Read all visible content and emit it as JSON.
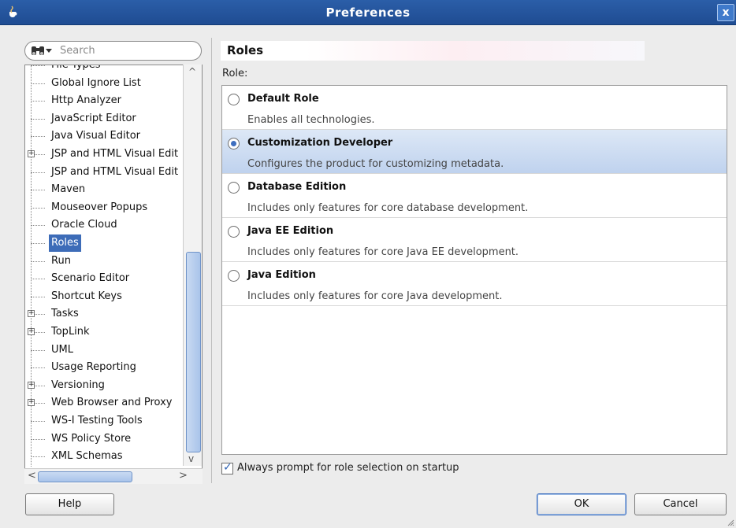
{
  "window": {
    "title": "Preferences",
    "close_label": "x"
  },
  "search": {
    "placeholder": "Search"
  },
  "tree": {
    "items": [
      {
        "label": "File Types",
        "expandable": false
      },
      {
        "label": "Global Ignore List",
        "expandable": false
      },
      {
        "label": "Http Analyzer",
        "expandable": false
      },
      {
        "label": "JavaScript Editor",
        "expandable": false
      },
      {
        "label": "Java Visual Editor",
        "expandable": false
      },
      {
        "label": "JSP and HTML Visual Edit",
        "expandable": true
      },
      {
        "label": "JSP and HTML Visual Edit",
        "expandable": false
      },
      {
        "label": "Maven",
        "expandable": false
      },
      {
        "label": "Mouseover Popups",
        "expandable": false
      },
      {
        "label": "Oracle Cloud",
        "expandable": false
      },
      {
        "label": "Roles",
        "expandable": false,
        "selected": true
      },
      {
        "label": "Run",
        "expandable": false
      },
      {
        "label": "Scenario Editor",
        "expandable": false
      },
      {
        "label": "Shortcut Keys",
        "expandable": false
      },
      {
        "label": "Tasks",
        "expandable": true
      },
      {
        "label": "TopLink",
        "expandable": true
      },
      {
        "label": "UML",
        "expandable": false
      },
      {
        "label": "Usage Reporting",
        "expandable": false
      },
      {
        "label": "Versioning",
        "expandable": true
      },
      {
        "label": "Web Browser and Proxy",
        "expandable": true
      },
      {
        "label": "WS-I Testing Tools",
        "expandable": false
      },
      {
        "label": "WS Policy Store",
        "expandable": false
      },
      {
        "label": "XML Schemas",
        "expandable": false
      }
    ]
  },
  "panel": {
    "title": "Roles",
    "role_label": "Role:",
    "roles": [
      {
        "name": "Default Role",
        "description": "Enables all technologies.",
        "selected": false
      },
      {
        "name": "Customization Developer",
        "description": "Configures the product for customizing metadata.",
        "selected": true
      },
      {
        "name": "Database Edition",
        "description": "Includes only features for core database development.",
        "selected": false
      },
      {
        "name": "Java EE Edition",
        "description": "Includes only features for core Java EE development.",
        "selected": false
      },
      {
        "name": "Java Edition",
        "description": "Includes only features for core Java development.",
        "selected": false
      }
    ],
    "prompt": {
      "label": "Always prompt for role selection on startup",
      "checked": true
    }
  },
  "buttons": {
    "help": "Help",
    "ok": "OK",
    "cancel": "Cancel"
  },
  "colors": {
    "title_bar": "#1f4c92",
    "selection": "#3d6cb8",
    "selected_row": "#bfd2ee"
  }
}
